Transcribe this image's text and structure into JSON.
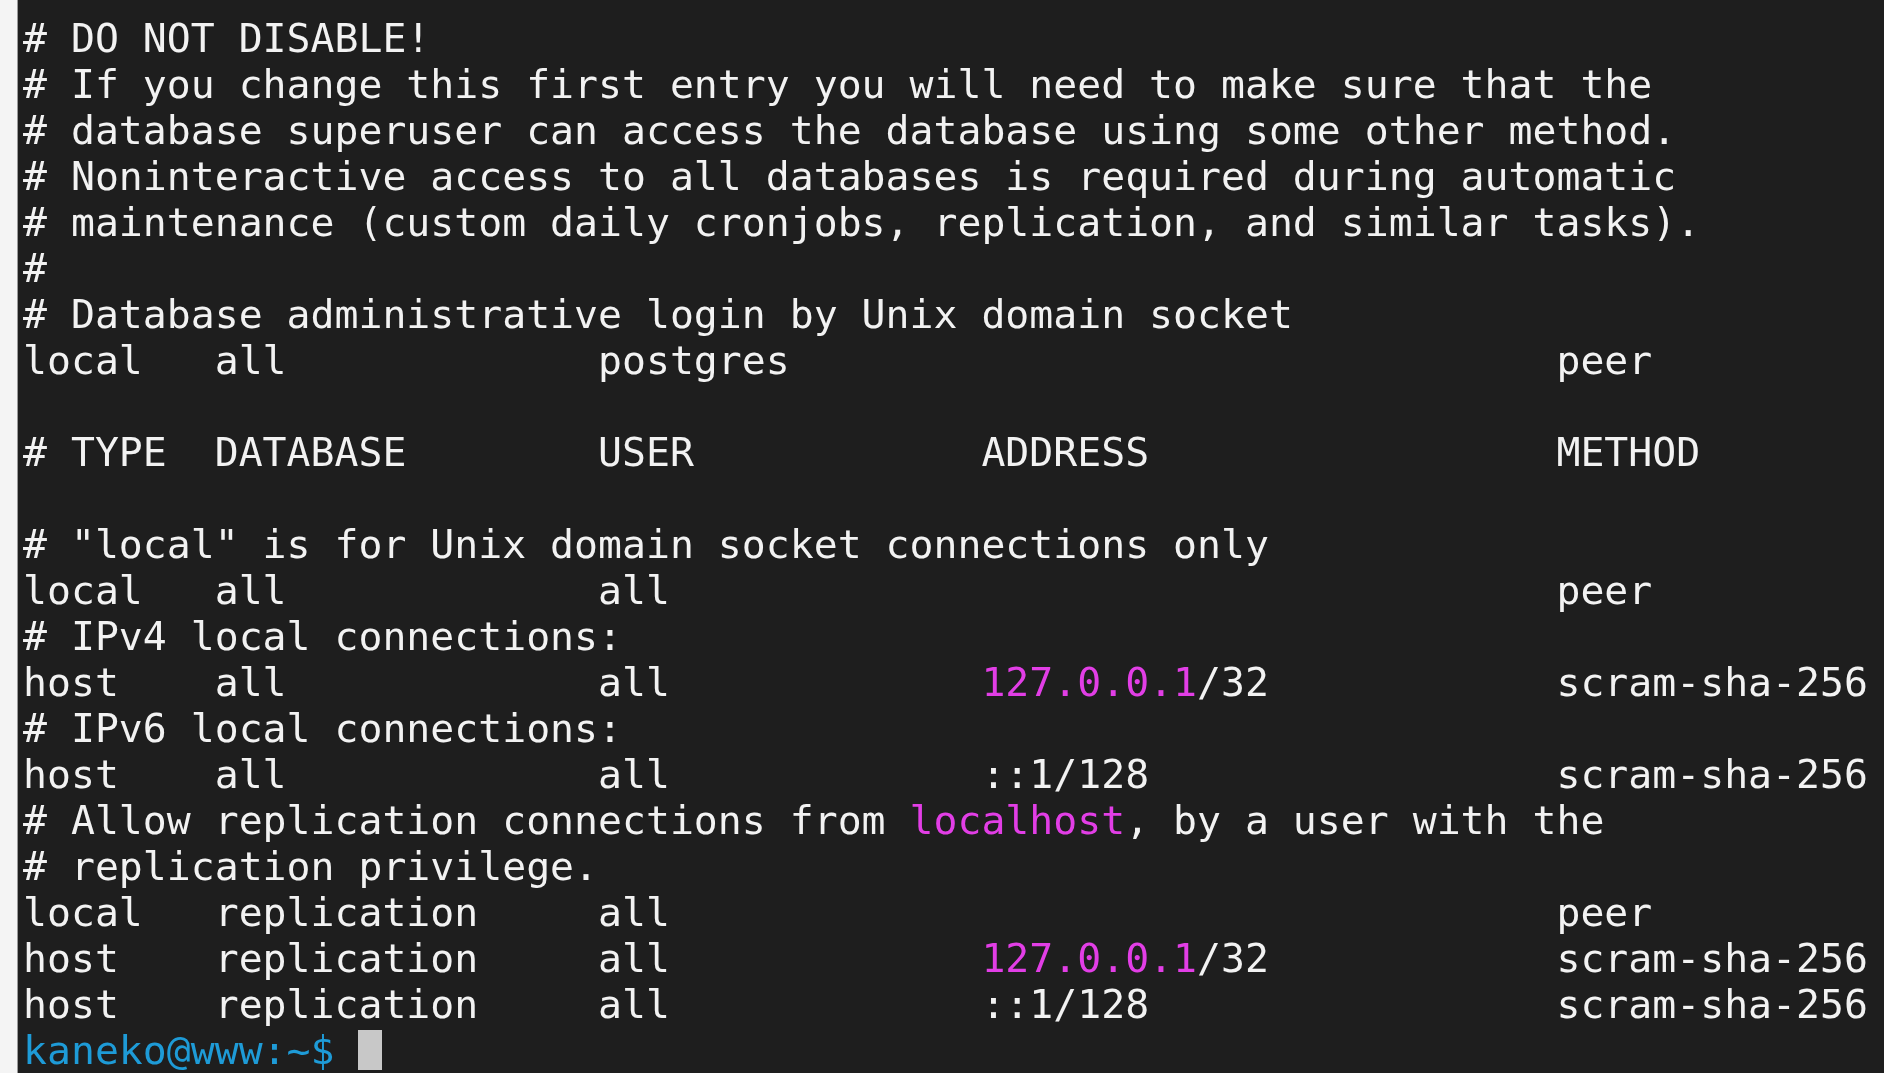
{
  "terminal": {
    "lines": [
      {
        "kind": "text",
        "parts": [
          {
            "text": "# DO NOT DISABLE!"
          }
        ]
      },
      {
        "kind": "text",
        "parts": [
          {
            "text": "# If you change this first entry you will need to make sure that the"
          }
        ]
      },
      {
        "kind": "text",
        "parts": [
          {
            "text": "# database superuser can access the database using some other method."
          }
        ]
      },
      {
        "kind": "text",
        "parts": [
          {
            "text": "# Noninteractive access to all databases is required during automatic"
          }
        ]
      },
      {
        "kind": "text",
        "parts": [
          {
            "text": "# maintenance (custom daily cronjobs, replication, and similar tasks)."
          }
        ]
      },
      {
        "kind": "text",
        "parts": [
          {
            "text": "#"
          }
        ]
      },
      {
        "kind": "text",
        "parts": [
          {
            "text": "# Database administrative login by Unix domain socket"
          }
        ]
      },
      {
        "kind": "text",
        "parts": [
          {
            "text": "local   all             postgres                                peer"
          }
        ]
      },
      {
        "kind": "blank"
      },
      {
        "kind": "text",
        "parts": [
          {
            "text": "# TYPE  DATABASE        USER            ADDRESS                 METHOD"
          }
        ]
      },
      {
        "kind": "blank"
      },
      {
        "kind": "text",
        "parts": [
          {
            "text": "# \"local\" is for Unix domain socket connections only"
          }
        ]
      },
      {
        "kind": "text",
        "parts": [
          {
            "text": "local   all             all                                     peer"
          }
        ]
      },
      {
        "kind": "text",
        "parts": [
          {
            "text": "# IPv4 local connections:"
          }
        ]
      },
      {
        "kind": "text",
        "parts": [
          {
            "text": "host    all             all             "
          },
          {
            "text": "127.0.0.1",
            "color": "#e23ee6"
          },
          {
            "text": "/32            scram-sha-256"
          }
        ]
      },
      {
        "kind": "text",
        "parts": [
          {
            "text": "# IPv6 local connections:"
          }
        ]
      },
      {
        "kind": "text",
        "parts": [
          {
            "text": "host    all             all             ::1/128                 scram-sha-256"
          }
        ]
      },
      {
        "kind": "text",
        "parts": [
          {
            "text": "# Allow replication connections from "
          },
          {
            "text": "localhost",
            "color": "#e23ee6"
          },
          {
            "text": ", by a user with the"
          }
        ]
      },
      {
        "kind": "text",
        "parts": [
          {
            "text": "# replication privilege."
          }
        ]
      },
      {
        "kind": "text",
        "parts": [
          {
            "text": "local   replication     all                                     peer"
          }
        ]
      },
      {
        "kind": "text",
        "parts": [
          {
            "text": "host    replication     all             "
          },
          {
            "text": "127.0.0.1",
            "color": "#e23ee6"
          },
          {
            "text": "/32            scram-sha-256"
          }
        ]
      },
      {
        "kind": "text",
        "parts": [
          {
            "text": "host    replication     all             ::1/128                 scram-sha-256"
          }
        ]
      },
      {
        "kind": "prompt",
        "text": "kaneko@www:~$",
        "cursor": true
      }
    ]
  }
}
